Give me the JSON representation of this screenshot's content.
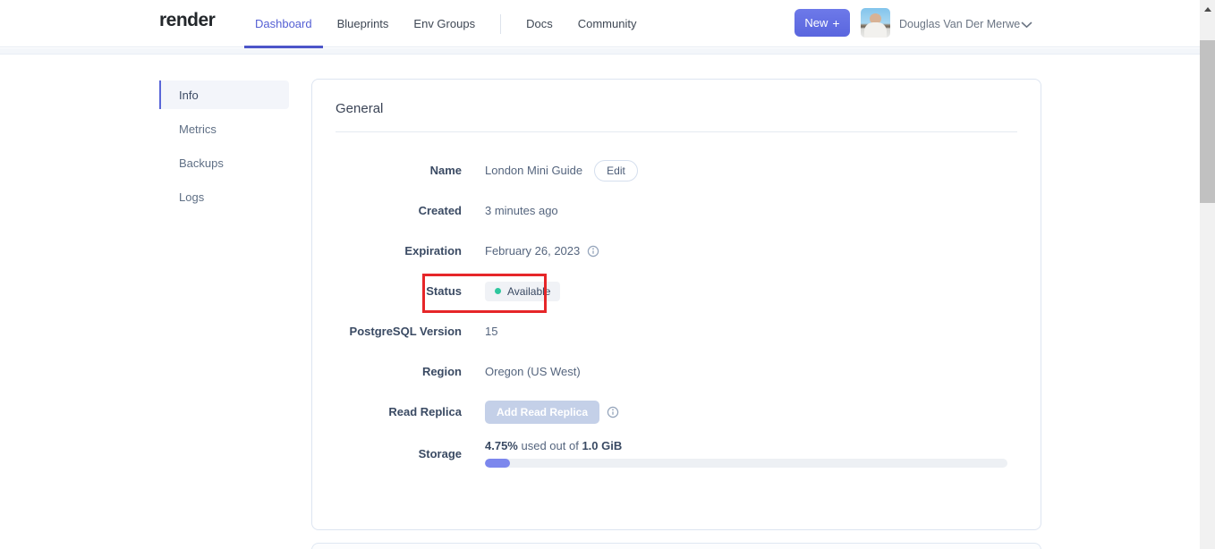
{
  "header": {
    "logo": "render",
    "nav": [
      {
        "label": "Dashboard",
        "active": true
      },
      {
        "label": "Blueprints",
        "active": false
      },
      {
        "label": "Env Groups",
        "active": false
      },
      {
        "label": "Docs",
        "active": false
      },
      {
        "label": "Community",
        "active": false
      }
    ],
    "new_button": {
      "label": "New",
      "plus": "+"
    },
    "user_name": "Douglas Van Der Merwe"
  },
  "sidebar": {
    "items": [
      {
        "label": "Info",
        "active": true
      },
      {
        "label": "Metrics",
        "active": false
      },
      {
        "label": "Backups",
        "active": false
      },
      {
        "label": "Logs",
        "active": false
      }
    ]
  },
  "card": {
    "title": "General",
    "rows": {
      "name": {
        "label": "Name",
        "value": "London Mini Guide",
        "edit_button": "Edit"
      },
      "created": {
        "label": "Created",
        "value": "3 minutes ago"
      },
      "expiration": {
        "label": "Expiration",
        "value": "February 26, 2023",
        "icon": "info-icon"
      },
      "status": {
        "label": "Status",
        "badge": "Available",
        "badge_color": "#2fc79e",
        "annotated": true
      },
      "pg_version": {
        "label": "PostgreSQL Version",
        "value": "15"
      },
      "region": {
        "label": "Region",
        "value": "Oregon (US West)"
      },
      "read_replica": {
        "label": "Read Replica",
        "disabled_button": "Add Read Replica",
        "icon": "info-icon"
      },
      "storage": {
        "label": "Storage",
        "percent": "4.75%",
        "middle": "used out of",
        "total": "1.0 GiB",
        "fill_percent": 4.75
      }
    }
  },
  "colors": {
    "accent": "#5a67d8",
    "annotation_red": "#e62629",
    "status_green": "#2fc79e",
    "progress_fill": "#7c87ed"
  }
}
